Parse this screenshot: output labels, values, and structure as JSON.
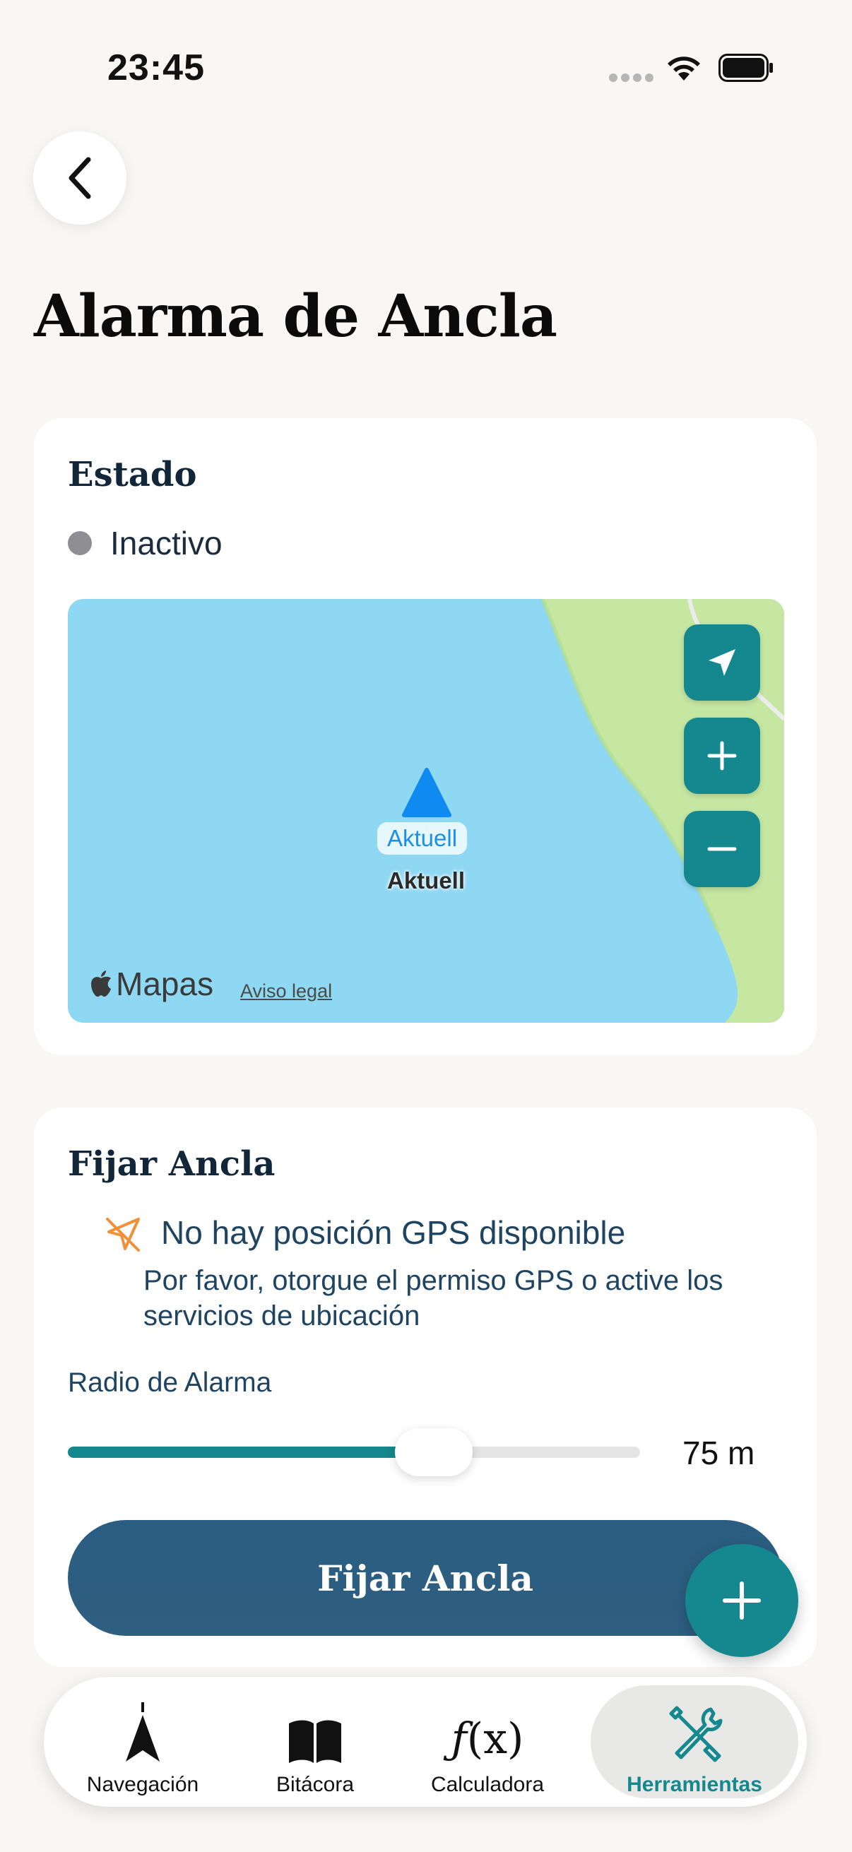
{
  "status_bar": {
    "time": "23:45"
  },
  "page": {
    "title": "Alarma de Ancla"
  },
  "status_card": {
    "title": "Estado",
    "status_text": "Inactivo",
    "status_color": "#8e8e93"
  },
  "map": {
    "marker_label": "Aktuell",
    "marker_caption": "Aktuell",
    "brand": "Mapas",
    "legal_link": "Aviso legal",
    "controls": [
      "location-arrow-icon",
      "zoom-in-icon",
      "zoom-out-icon"
    ]
  },
  "anchor_card": {
    "title": "Fijar Ancla",
    "gps_warning_title": "No hay posición GPS disponible",
    "gps_warning_detail": "Por favor, otorgue el permiso GPS o active los servicios de ubicación",
    "radius_label": "Radio de Alarma",
    "radius_value": "75 m",
    "radius_slider_fraction": 0.64,
    "set_anchor_button": "Fijar Ancla"
  },
  "tab_bar": {
    "items": [
      {
        "label": "Navegación",
        "icon": "compass-needle-icon",
        "active": false
      },
      {
        "label": "Bitácora",
        "icon": "book-icon",
        "active": false
      },
      {
        "label": "Calculadora",
        "icon": "function-icon",
        "active": false
      },
      {
        "label": "Herramientas",
        "icon": "tools-icon",
        "active": true
      }
    ]
  },
  "colors": {
    "accent": "#14888e",
    "primary_button": "#2d5e80",
    "background": "#f8f7f5",
    "water": "#8fd8f3",
    "land": "#c5e7a2"
  }
}
